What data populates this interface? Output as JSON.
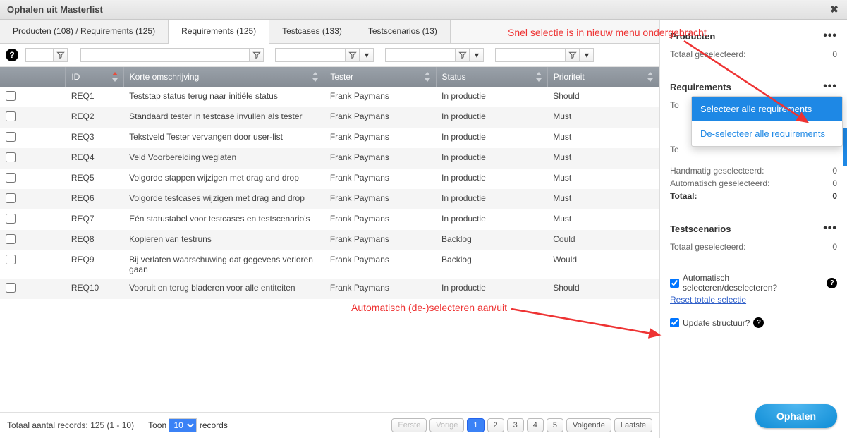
{
  "titlebar": {
    "title": "Ophalen uit Masterlist"
  },
  "tabs": [
    "Producten (108) / Requirements (125)",
    "Requirements (125)",
    "Testcases (133)",
    "Testscenarios (13)"
  ],
  "active_tab": 1,
  "columns": {
    "id": "ID",
    "desc": "Korte omschrijving",
    "tester": "Tester",
    "status": "Status",
    "pri": "Prioriteit"
  },
  "rows": [
    {
      "id": "REQ1",
      "desc": "Teststap status terug naar initiële status",
      "tester": "Frank Paymans",
      "status": "In productie",
      "pri": "Should"
    },
    {
      "id": "REQ2",
      "desc": "Standaard tester in testcase invullen als tester",
      "tester": "Frank Paymans",
      "status": "In productie",
      "pri": "Must"
    },
    {
      "id": "REQ3",
      "desc": "Tekstveld Tester vervangen door user-list",
      "tester": "Frank Paymans",
      "status": "In productie",
      "pri": "Must"
    },
    {
      "id": "REQ4",
      "desc": "Veld Voorbereiding weglaten",
      "tester": "Frank Paymans",
      "status": "In productie",
      "pri": "Must"
    },
    {
      "id": "REQ5",
      "desc": "Volgorde stappen wijzigen met drag and drop",
      "tester": "Frank Paymans",
      "status": "In productie",
      "pri": "Must"
    },
    {
      "id": "REQ6",
      "desc": "Volgorde testcases wijzigen met drag and drop",
      "tester": "Frank Paymans",
      "status": "In productie",
      "pri": "Must"
    },
    {
      "id": "REQ7",
      "desc": "Eén statustabel voor testcases en testscenario's",
      "tester": "Frank Paymans",
      "status": "In productie",
      "pri": "Must"
    },
    {
      "id": "REQ8",
      "desc": "Kopieren van testruns",
      "tester": "Frank Paymans",
      "status": "Backlog",
      "pri": "Could"
    },
    {
      "id": "REQ9",
      "desc": "Bij verlaten waarschuwing dat gegevens verloren gaan",
      "tester": "Frank Paymans",
      "status": "Backlog",
      "pri": "Would"
    },
    {
      "id": "REQ10",
      "desc": "Vooruit en terug bladeren voor alle entiteiten",
      "tester": "Frank Paymans",
      "status": "In productie",
      "pri": "Should"
    }
  ],
  "footer": {
    "total_label": "Totaal aantal records: 125 (1 - 10)",
    "show_label_pre": "Toon",
    "show_value": "10",
    "show_label_post": "records",
    "pager": {
      "first": "Eerste",
      "prev": "Vorige",
      "pages": [
        "1",
        "2",
        "3",
        "4",
        "5"
      ],
      "next": "Volgende",
      "last": "Laatste",
      "active": 0
    }
  },
  "right": {
    "producten": {
      "title": "Producten",
      "selected_label": "Totaal geselecteerd:",
      "selected_value": "0"
    },
    "requirements": {
      "title": "Requirements",
      "menu": {
        "select_all": "Selecteer alle requirements",
        "deselect_all": "De-selecteer alle requirements"
      },
      "rows": [
        {
          "label": "Handmatig geselecteerd:",
          "value": "0"
        },
        {
          "label": "Automatisch geselecteerd:",
          "value": "0"
        },
        {
          "label": "Totaal:",
          "value": "0",
          "bold": true
        }
      ],
      "truncated_prefix1": "To",
      "truncated_prefix2": "Te"
    },
    "testscenarios": {
      "title": "Testscenarios",
      "selected_label": "Totaal geselecteerd:",
      "selected_value": "0"
    },
    "auto_select": "Automatisch selecteren/deselecteren?",
    "reset": "Reset totale selectie ",
    "update_struct": "Update structuur?"
  },
  "button": {
    "ophalen": "Ophalen"
  },
  "annotations": {
    "top": "Snel selectie is in nieuw menu ondergebracht",
    "mid": "Automatisch (de-)selecteren aan/uit"
  }
}
